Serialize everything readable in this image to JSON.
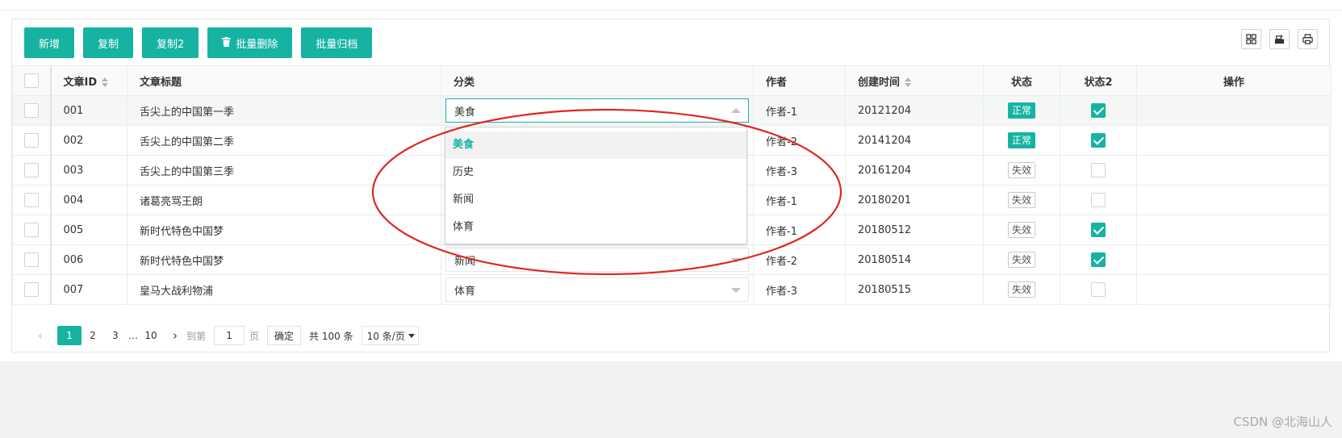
{
  "toolbar": {
    "buttons": [
      {
        "label": "新增"
      },
      {
        "label": "复制"
      },
      {
        "label": "复制2"
      },
      {
        "label": "批量删除",
        "icon": "trash-icon"
      },
      {
        "label": "批量归档"
      }
    ],
    "right_icons": [
      "columns-icon",
      "export-icon",
      "print-icon"
    ]
  },
  "table": {
    "headers": {
      "id": "文章ID",
      "title": "文章标题",
      "category": "分类",
      "author": "作者",
      "created": "创建时间",
      "status": "状态",
      "status2": "状态2",
      "actions": "操作"
    },
    "rows": [
      {
        "id": "001",
        "title": "舌尖上的中国第一季",
        "category": "美食",
        "author": "作者-1",
        "created": "20121204",
        "status": "正常",
        "status_ok": true,
        "status2": true
      },
      {
        "id": "002",
        "title": "舌尖上的中国第二季",
        "category": "",
        "author": "作者-2",
        "created": "20141204",
        "status": "正常",
        "status_ok": true,
        "status2": true
      },
      {
        "id": "003",
        "title": "舌尖上的中国第三季",
        "category": "",
        "author": "作者-3",
        "created": "20161204",
        "status": "失效",
        "status_ok": false,
        "status2": false
      },
      {
        "id": "004",
        "title": "诸葛亮骂王朗",
        "category": "",
        "author": "作者-1",
        "created": "20180201",
        "status": "失效",
        "status_ok": false,
        "status2": false
      },
      {
        "id": "005",
        "title": "新时代特色中国梦",
        "category": "",
        "author": "作者-1",
        "created": "20180512",
        "status": "失效",
        "status_ok": false,
        "status2": true
      },
      {
        "id": "006",
        "title": "新时代特色中国梦",
        "category": "新闻",
        "author": "作者-2",
        "created": "20180514",
        "status": "失效",
        "status_ok": false,
        "status2": true
      },
      {
        "id": "007",
        "title": "皇马大战利物浦",
        "category": "体育",
        "author": "作者-3",
        "created": "20180515",
        "status": "失效",
        "status_ok": false,
        "status2": false
      }
    ]
  },
  "dropdown": {
    "options": [
      "美食",
      "历史",
      "新闻",
      "体育"
    ],
    "selected_index": 0
  },
  "pager": {
    "pages": [
      "1",
      "2",
      "3"
    ],
    "ellipsis": "…",
    "last": "10",
    "goto_label": "到第",
    "goto_value": "1",
    "page_unit": "页",
    "confirm": "确定",
    "total": "共 100 条",
    "page_size": "10 条/页"
  },
  "annotation": {
    "color": "#e0261b"
  },
  "accent_color": "#16b3a3",
  "watermark": "CSDN @北海山人"
}
